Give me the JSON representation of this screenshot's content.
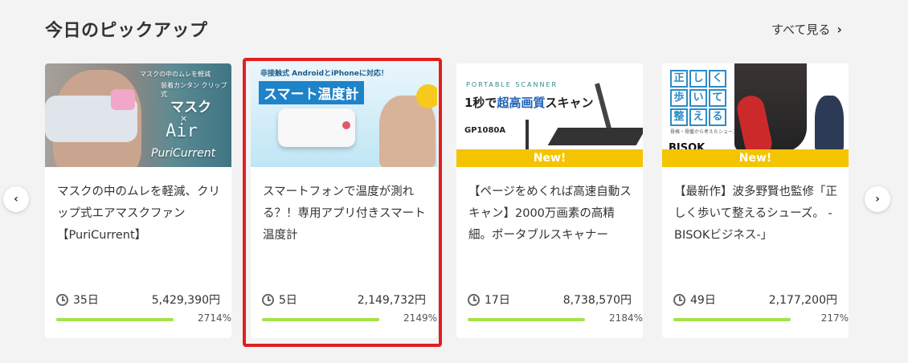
{
  "section": {
    "title": "今日のピックアップ",
    "see_all": "すべて見る"
  },
  "nav": {
    "prev_icon": "chevron-left-icon",
    "next_icon": "chevron-right-icon"
  },
  "colors": {
    "progress": "#a5e24a",
    "new_badge": "#f5c400",
    "highlight": "#e02020"
  },
  "cards": [
    {
      "title": "マスクの中のムレを軽減、クリップ式エアマスクファン【PuriCurrent】",
      "days": "35日",
      "amount": "5,429,390円",
      "percent": "2714%",
      "progress": 1.0,
      "thumb": {
        "line1": "マスクの中のムレを軽減",
        "line2": "装着カンタン クリップ式",
        "big": "マスク",
        "x": "×",
        "air": "Air",
        "brand": "PuriCurrent"
      }
    },
    {
      "title": "スマートフォンで温度が測れる？！専用アプリ付きスマート温度計",
      "days": "5日",
      "amount": "2,149,732円",
      "percent": "2149%",
      "progress": 1.0,
      "selected": true,
      "thumb": {
        "sub": "非接触式 AndroidとiPhoneに対応！",
        "banner": "スマート温度計"
      }
    },
    {
      "title": "【ページをめくれば高速自動スキャン】2000万画素の高精細。ポータブルスキャナー",
      "days": "17日",
      "amount": "8,738,570円",
      "percent": "2184%",
      "progress": 1.0,
      "thumb": {
        "label": "PORTABLE SCANNER",
        "head_a": "1秒で",
        "head_b": "超高画質",
        "head_c": "スキャン",
        "model": "GP1080A",
        "new": "New!"
      }
    },
    {
      "title": "【最新作】波多野賢也監修「正しく歩いて整えるシューズ。 -BISOKビジネス-」",
      "days": "49日",
      "amount": "2,177,200円",
      "percent": "217%",
      "progress": 1.0,
      "thumb": {
        "k": [
          "正",
          "し",
          "く",
          "歩",
          "い",
          "て",
          "整",
          "え",
          "る"
        ],
        "cap": "骨格・骨盤から考えたシューズ",
        "brand": "BISOK",
        "new": "New!"
      }
    }
  ]
}
